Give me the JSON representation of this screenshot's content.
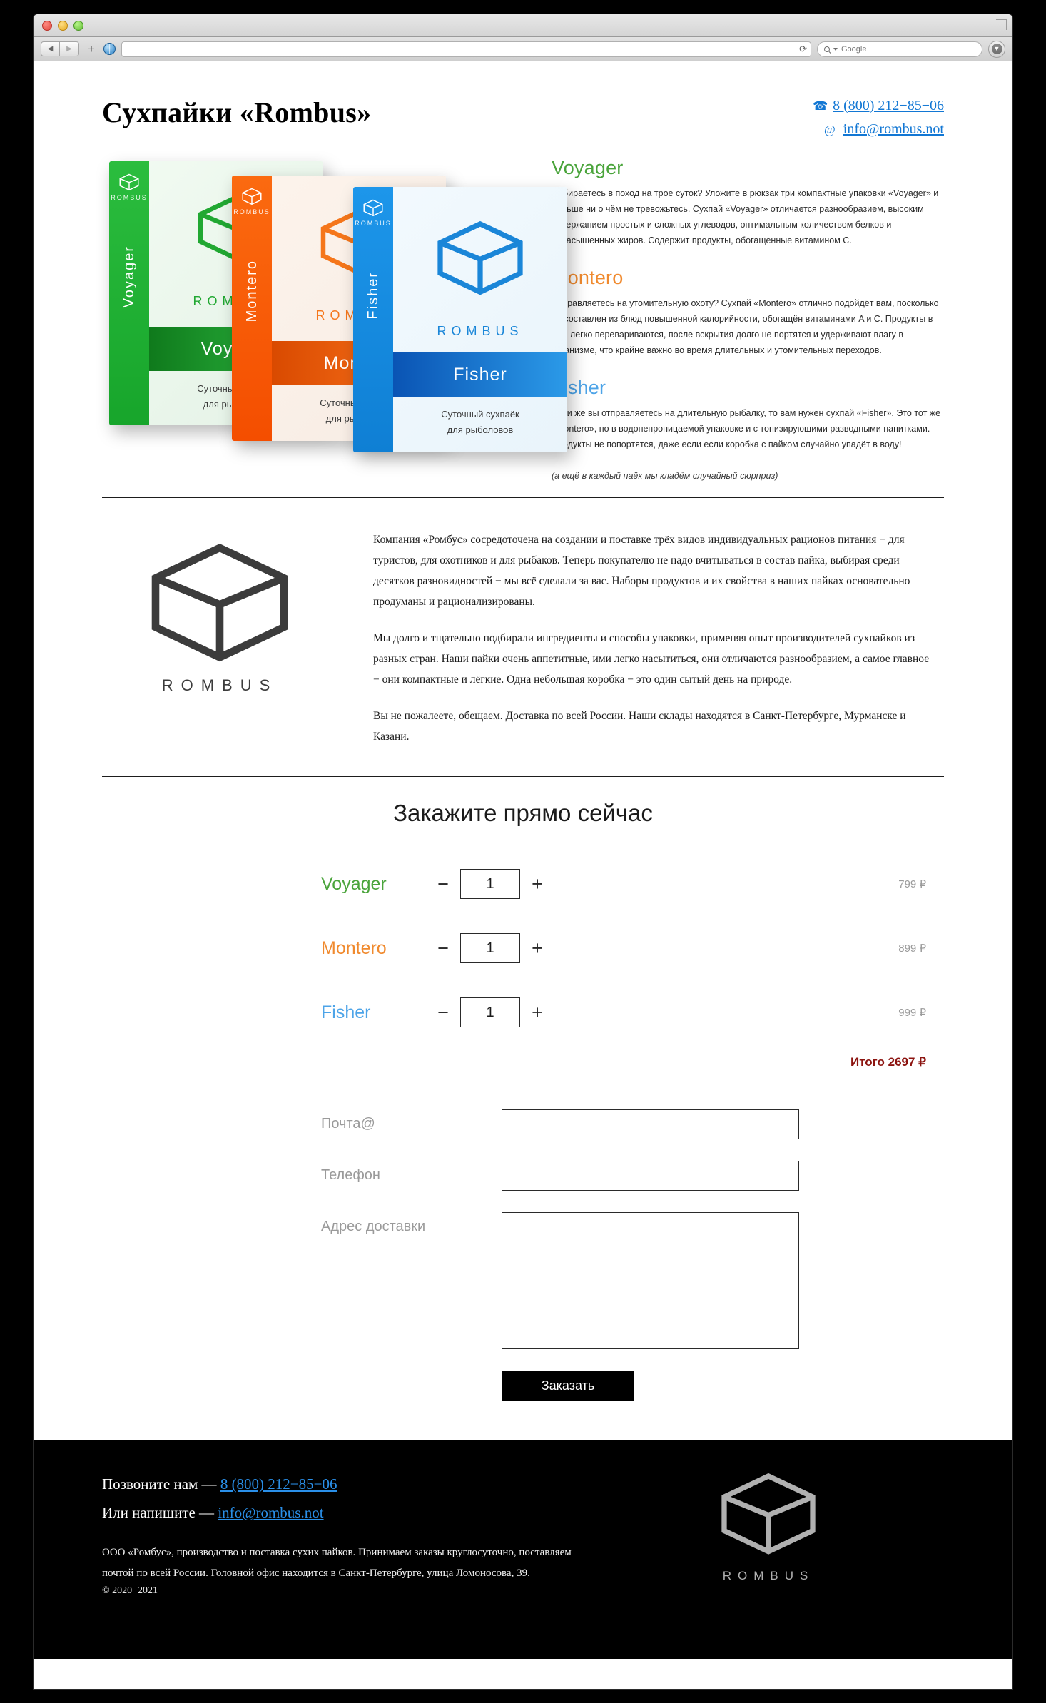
{
  "browser": {
    "search_placeholder": "Google",
    "reload_icon": "reload-icon",
    "back_icon": "back-arrow-icon",
    "forward_icon": "forward-arrow-icon",
    "new_tab_icon": "plus-icon",
    "site_icon": "globe-icon",
    "download_icon": "download-icon"
  },
  "header": {
    "title": "Сухпайки «Rombus»",
    "phone": "8 (800) 212−85−06",
    "phone_icon": "phone-icon",
    "email": "info@rombus.not",
    "email_icon": "at-sign-icon"
  },
  "products": [
    {
      "name": "Voyager",
      "color": "#4aa43b",
      "heading": "Voyager",
      "text": "Собираетесь в поход на трое суток? Уложите в рюкзак три компактные упаковки «Voyager» и больше ни о чём не тревожьтесь. Сухпай «Voyager» отличается разнообразием, высоким содержанием простых и сложных углеводов, оптимальным количеством белков и ненасыщенных жиров. Содержит продукты, обогащенные витамином С."
    },
    {
      "name": "Montero",
      "color": "#f08a2e",
      "heading": "Montero",
      "text": "Отправляетесь на утомительную охоту? Сухпай «Montero» отлично подойдёт вам, посколько он составлен из блюд повышенной калорийности, обогащён витаминами A и C. Продукты в нём легко перевариваются, после вскрытия долго не портятся и удерживают влагу в организме, что крайне важно во время длительных и утомительных переходов."
    },
    {
      "name": "Fisher",
      "color": "#4da4e8",
      "heading": "Fisher",
      "text": "Если же вы отправляетесь на длительную рыбалку, то вам нужен сухпай «Fisher». Это тот же «Montero», но в водонепроницаемой упаковке и с тонизирующими разводными напитками. Продукты не попортятся, даже если если коробка с пайком случайно упадёт в воду!"
    }
  ],
  "hero_note": "(а ещё в каждый паёк мы кладём случайный сюрприз)",
  "boxart": {
    "brand_word": "ROMBUS",
    "voyager_spine": "Voyager",
    "montero_spine": "Montero",
    "fisher_spine": "Fisher",
    "voyager_band": "Voyager",
    "montero_band": "Montero",
    "fisher_band": "Fisher",
    "sub_line1": "Суточный сухпаёк",
    "sub_line2": "для рыболовов"
  },
  "about": {
    "logo_word": "ROMBUS",
    "paragraphs": [
      "Компания «Ромбус» сосредоточена на создании и поставке трёх видов индивидуальных рационов питания − для туристов, для охотников и для рыбаков. Теперь покупателю не надо вчитываться в состав пайка, выбирая среди десятков разновидностей − мы всё сделали за вас. Наборы продуктов и их свойства в наших пайках основательно продуманы и рационализированы.",
      "Мы долго и тщательно подбирали ингредиенты и способы упаковки, применяя опыт производителей сухпайков из разных стран. Наши пайки очень аппетитные, ими легко насытиться, они отличаются разнообразием, а самое главное − они компактные и лёгкие. Одна небольшая коробка − это один сытый день на природе.",
      "Вы не пожалеете, обещаем. Доставка по всей России. Наши склады находятся в Санкт-Петербурге, Мурманске и Казани."
    ]
  },
  "order": {
    "title": "Закажите прямо сейчас",
    "minus_label": "−",
    "plus_label": "+",
    "rows": [
      {
        "name": "Voyager",
        "qty": "1",
        "price": "799 ₽"
      },
      {
        "name": "Montero",
        "qty": "1",
        "price": "899 ₽"
      },
      {
        "name": "Fisher",
        "qty": "1",
        "price": "999 ₽"
      }
    ],
    "total": "Итого 2697 ₽",
    "fields": [
      {
        "label": "Почта@",
        "value": ""
      },
      {
        "label": "Телефон",
        "value": ""
      },
      {
        "label": "Адрес доставки",
        "value": ""
      }
    ],
    "submit": "Заказать"
  },
  "footer": {
    "call_prefix": "Позвоните нам — ",
    "phone": "8 (800) 212−85−06",
    "write_prefix": "Или напишите — ",
    "email": "info@rombus.not",
    "legal": "ООО «Ромбус», производство и поставка сухих пайков. Принимаем заказы круглосуточно, поставляем почтой по всей России. Головной офис находится в Санкт-Петербурге, улица Ломоносова, 39.",
    "copyright": "© 2020−2021",
    "logo_word": "ROMBUS"
  }
}
